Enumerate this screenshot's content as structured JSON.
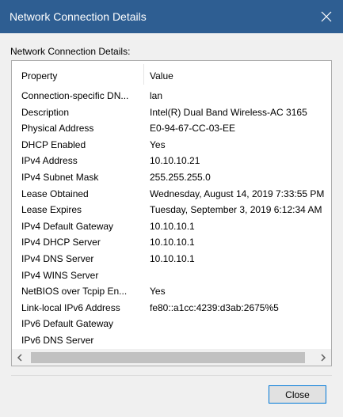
{
  "window": {
    "title": "Network Connection Details",
    "close_icon": "close-icon"
  },
  "section_label": "Network Connection Details:",
  "columns": {
    "property": "Property",
    "value": "Value"
  },
  "rows": [
    {
      "property": "Connection-specific DN...",
      "value": "lan"
    },
    {
      "property": "Description",
      "value": "Intel(R) Dual Band Wireless-AC 3165"
    },
    {
      "property": "Physical Address",
      "value": "E0-94-67-CC-03-EE"
    },
    {
      "property": "DHCP Enabled",
      "value": "Yes"
    },
    {
      "property": "IPv4 Address",
      "value": "10.10.10.21"
    },
    {
      "property": "IPv4 Subnet Mask",
      "value": "255.255.255.0"
    },
    {
      "property": "Lease Obtained",
      "value": "Wednesday, August 14, 2019 7:33:55 PM"
    },
    {
      "property": "Lease Expires",
      "value": "Tuesday, September 3, 2019 6:12:34 AM"
    },
    {
      "property": "IPv4 Default Gateway",
      "value": "10.10.10.1"
    },
    {
      "property": "IPv4 DHCP Server",
      "value": "10.10.10.1"
    },
    {
      "property": "IPv4 DNS Server",
      "value": "10.10.10.1"
    },
    {
      "property": "IPv4 WINS Server",
      "value": ""
    },
    {
      "property": "NetBIOS over Tcpip En...",
      "value": "Yes"
    },
    {
      "property": "Link-local IPv6 Address",
      "value": "fe80::a1cc:4239:d3ab:2675%5"
    },
    {
      "property": "IPv6 Default Gateway",
      "value": ""
    },
    {
      "property": "IPv6 DNS Server",
      "value": ""
    }
  ],
  "scrollbar": {
    "left_icon": "chevron-left-icon",
    "right_icon": "chevron-right-icon"
  },
  "buttons": {
    "close_label": "Close"
  },
  "colors": {
    "titlebar": "#2e5e92",
    "button_border": "#0078d7"
  }
}
